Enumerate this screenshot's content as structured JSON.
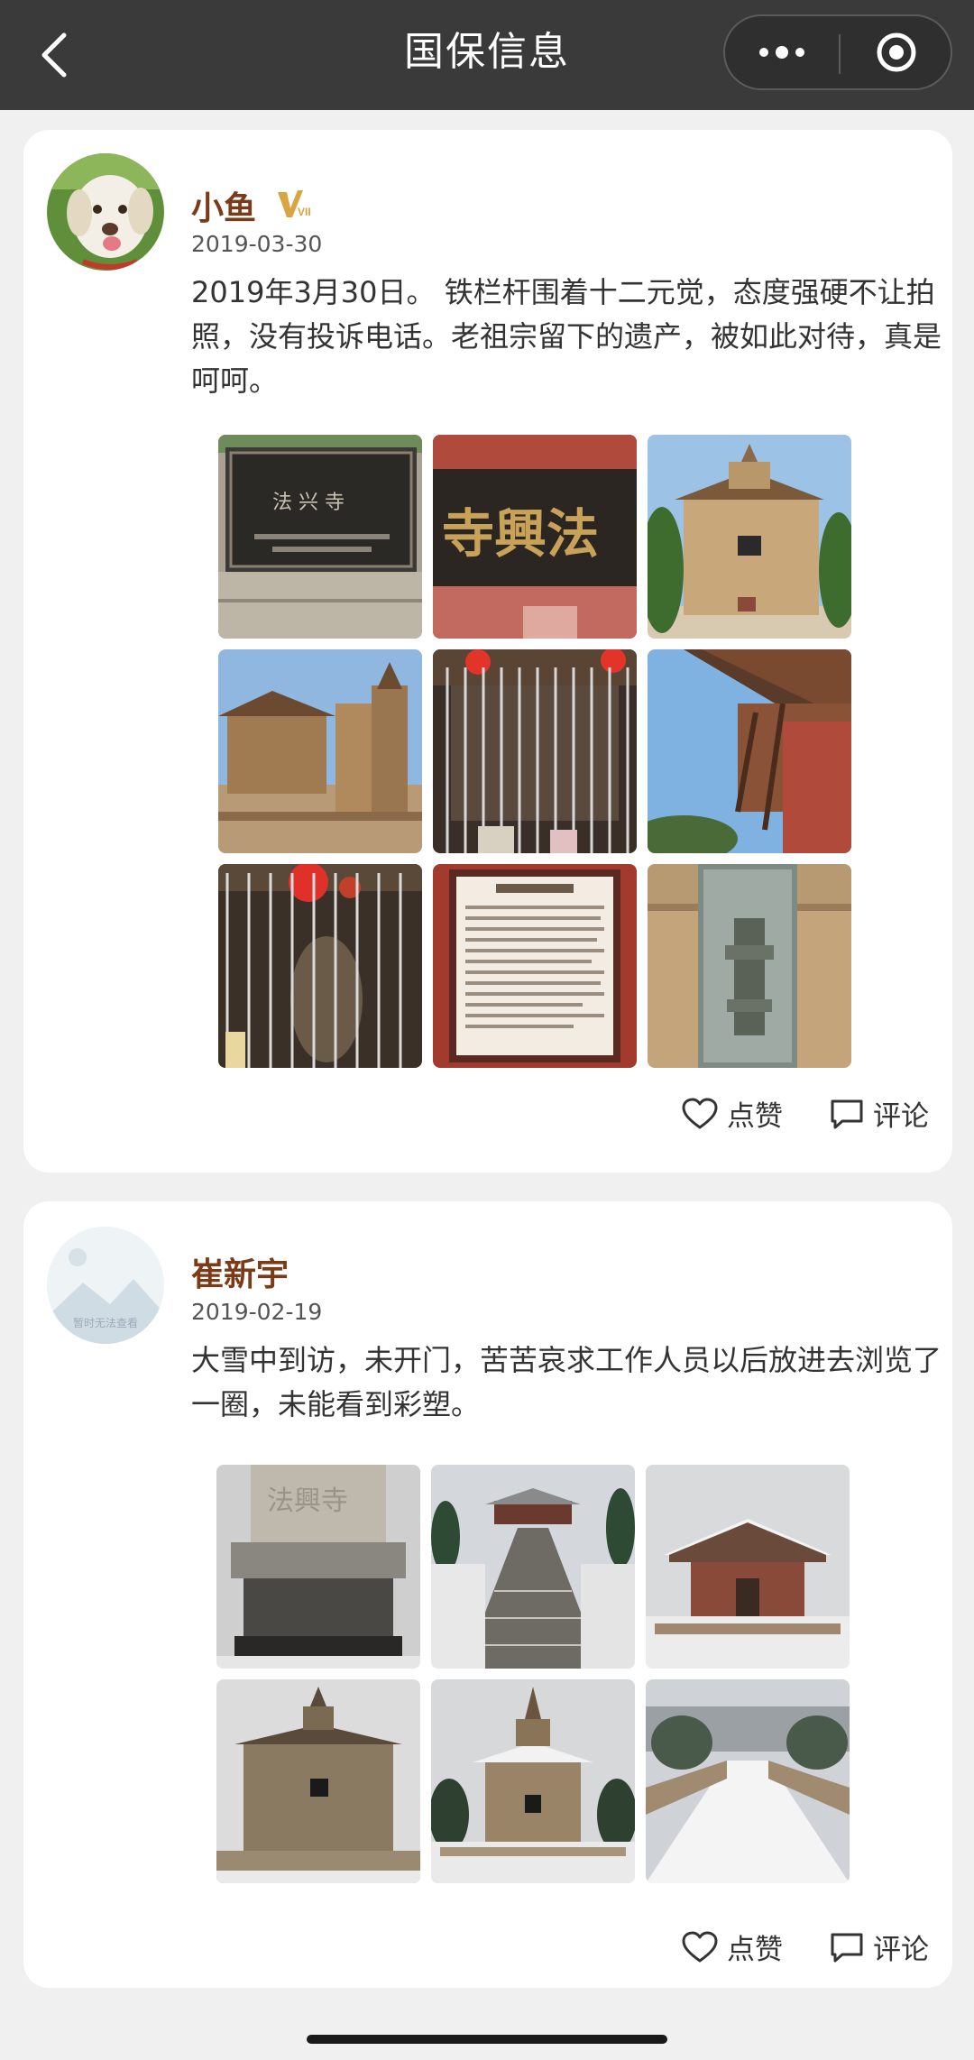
{
  "navbar": {
    "title": "国保信息",
    "back_icon": "chevron-left-icon",
    "more_icon": "more-dots-icon",
    "close_icon": "target-circle-icon"
  },
  "posts": [
    {
      "user_name": "小鱼",
      "badge": "VIP",
      "date": "2019-03-30",
      "text": "2019年3月30日。 铁栏杆围着十二元觉，态度强硬不让拍照，没有投诉电话。老祖宗留下的遗产，被如此对待，真是呵呵。",
      "photos": [
        {
          "subject": "stone tablet 法兴寺"
        },
        {
          "subject": "gold-lettered plaque 法興寺"
        },
        {
          "subject": "brick pagoda under blue sky"
        },
        {
          "subject": "temple courtyard with pagoda"
        },
        {
          "subject": "iron bars with red lanterns"
        },
        {
          "subject": "temple eaves"
        },
        {
          "subject": "statue behind bars"
        },
        {
          "subject": "notice board"
        },
        {
          "subject": "glass-enclosed stone lantern"
        }
      ],
      "like_label": "点赞",
      "comment_label": "评论"
    },
    {
      "user_name": "崔新宇",
      "avatar_text": "暂时无法查看",
      "date": "2019-02-19",
      "text": "大雪中到访，未开门，苦苦哀求工作人员以后放进去浏览了一圈，未能看到彩塑。",
      "photos": [
        {
          "subject": "stone stele in snow"
        },
        {
          "subject": "snowy stairway to temple"
        },
        {
          "subject": "snowy temple hall"
        },
        {
          "subject": "pagoda hall in snow"
        },
        {
          "subject": "snow-covered pagoda"
        },
        {
          "subject": "snowy bridge walkway"
        }
      ],
      "like_label": "点赞",
      "comment_label": "评论"
    }
  ],
  "colors": {
    "navbar_bg": "#3a3a3a",
    "user_name": "#7a3b18",
    "vip_gold": "#d9a441",
    "page_bg": "#f0f0f0"
  }
}
